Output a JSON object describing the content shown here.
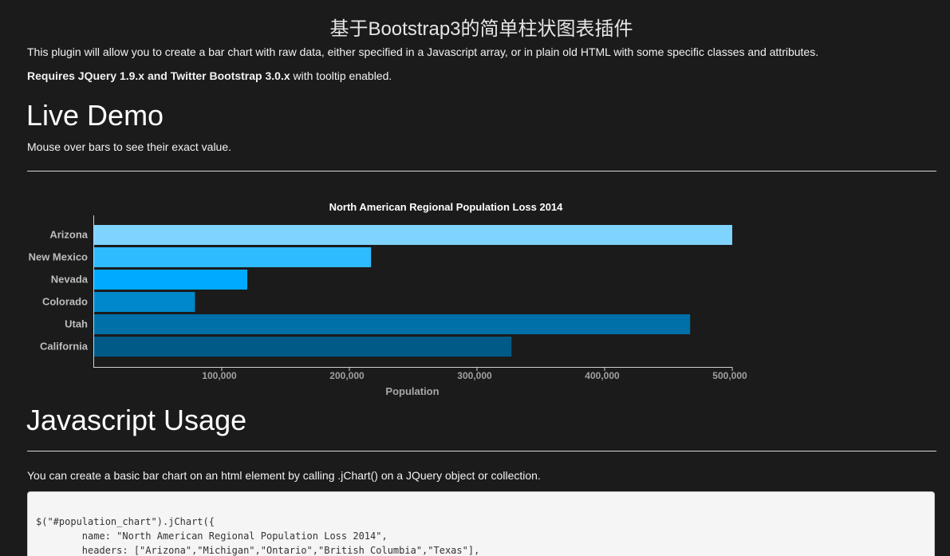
{
  "page": {
    "site_title": "基于Bootstrap3的简单柱状图表插件",
    "intro": "This plugin will allow you to create a bar chart with raw data, either specified in a Javascript array, or in plain old HTML with some specific classes and attributes.",
    "requires_bold": "Requires JQuery 1.9.x and Twitter Bootstrap 3.0.x",
    "requires_rest": " with tooltip enabled.",
    "live_demo_heading": "Live Demo",
    "mouse_over_text": "Mouse over bars to see their exact value.",
    "js_usage_heading": "Javascript Usage",
    "usage_text": "You can create a basic bar chart on an html element by calling .jChart() on a JQuery object or collection.",
    "code_lines": [
      "$(\"#population_chart\").jChart({",
      "        name: \"North American Regional Population Loss 2014\",",
      "        headers: [\"Arizona\",\"Michigan\",\"Ontario\",\"British Columbia\",\"Texas\"],"
    ]
  },
  "chart_data": {
    "type": "bar",
    "orientation": "horizontal",
    "title": "North American Regional Population Loss 2014",
    "xlabel": "Population",
    "ylabel": "",
    "categories": [
      "Arizona",
      "New Mexico",
      "Nevada",
      "Colorado",
      "Utah",
      "California"
    ],
    "values": [
      500000,
      217000,
      120000,
      79000,
      467000,
      327000
    ],
    "colors": [
      "#7fd4ff",
      "#2fbbff",
      "#00aaff",
      "#0088cc",
      "#0070a8",
      "#005a87"
    ],
    "xlim": [
      0,
      500000
    ],
    "x_ticks": [
      100000,
      200000,
      300000,
      400000,
      500000
    ],
    "x_tick_labels": [
      "100,000",
      "200,000",
      "300,000",
      "400,000",
      "500,000"
    ],
    "grid": false,
    "legend": "none"
  }
}
